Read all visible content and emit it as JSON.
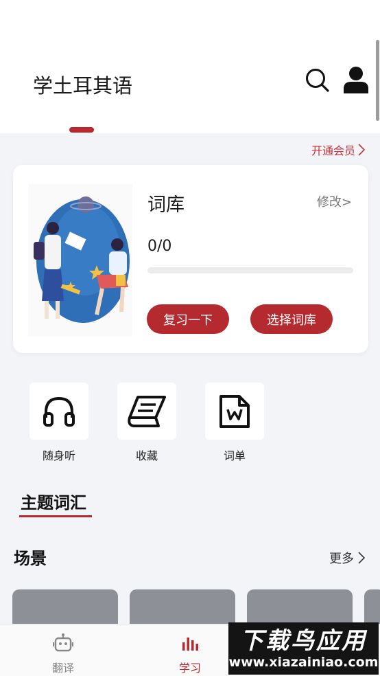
{
  "header": {
    "title": "学土耳其语"
  },
  "vip": {
    "label": "开通会员"
  },
  "library": {
    "title": "词库",
    "edit_label": "修改>",
    "progress_text": "0/0",
    "progress_fraction": 0,
    "review_button": "复习一下",
    "select_button": "选择词库"
  },
  "quick_actions": [
    {
      "label": "随身听",
      "icon": "headphones-icon"
    },
    {
      "label": "收藏",
      "icon": "book-icon"
    },
    {
      "label": "词单",
      "icon": "word-document-icon"
    }
  ],
  "topics": {
    "title": "主题词汇"
  },
  "scenes": {
    "title": "场景",
    "more_label": "更多"
  },
  "bottom_nav": [
    {
      "label": "翻译",
      "icon": "robot-icon",
      "active": false
    },
    {
      "label": "学习",
      "icon": "bar-chart-icon",
      "active": true
    }
  ],
  "watermark": {
    "main": "下载鸟应用",
    "sub": "www.xiazainiao.com"
  },
  "colors": {
    "accent": "#b8282d",
    "background": "#f3f4f7",
    "card": "#ffffff",
    "scene_card": "#8e9097"
  }
}
